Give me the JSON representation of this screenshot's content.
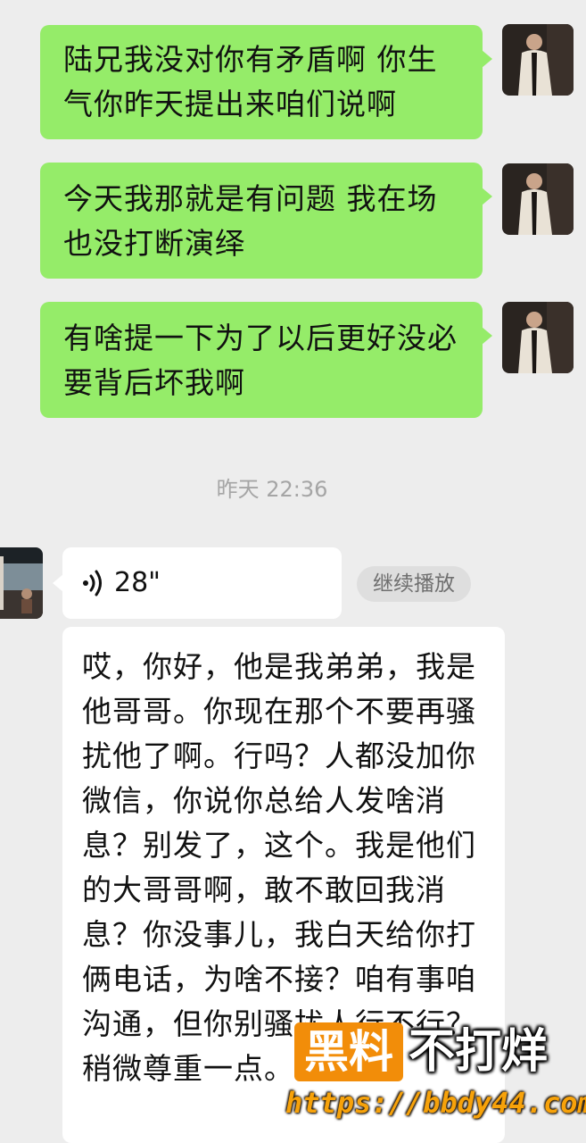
{
  "chat": {
    "outgoing_messages": [
      {
        "text": "陆兄我没对你有矛盾啊 你生气你昨天提出来咱们说啊"
      },
      {
        "text": "今天我那就是有问题 我在场也没打断演绎"
      },
      {
        "text": "有啥提一下为了以后更好没必要背后坏我啊"
      }
    ],
    "timestamp": "昨天 22:36",
    "voice_message": {
      "duration": "28\"",
      "continue_play_label": "继续播放"
    },
    "voice_transcript": "哎，你好，他是我弟弟，我是他哥哥。你现在那个不要再骚扰他了啊。行吗？人都没加你微信，你说你总给人发啥消息？别发了，这个。我是他们的大哥哥啊，敢不敢回我消息？你没事儿，我白天给你打俩电话，为啥不接？咱有事咱沟通，但你别骚扰人行不行？稍微尊重一点。"
  },
  "watermark": {
    "box_text": "黑料",
    "rest_text": "不打烊",
    "url": "https://bbdy44.com"
  },
  "colors": {
    "background": "#ededed",
    "outgoing_bubble": "#95ec69",
    "incoming_bubble": "#ffffff",
    "timestamp_text": "#a5a5a5",
    "watermark_orange": "#f28d09"
  },
  "icons": {
    "voice": "voice-wave-icon"
  }
}
